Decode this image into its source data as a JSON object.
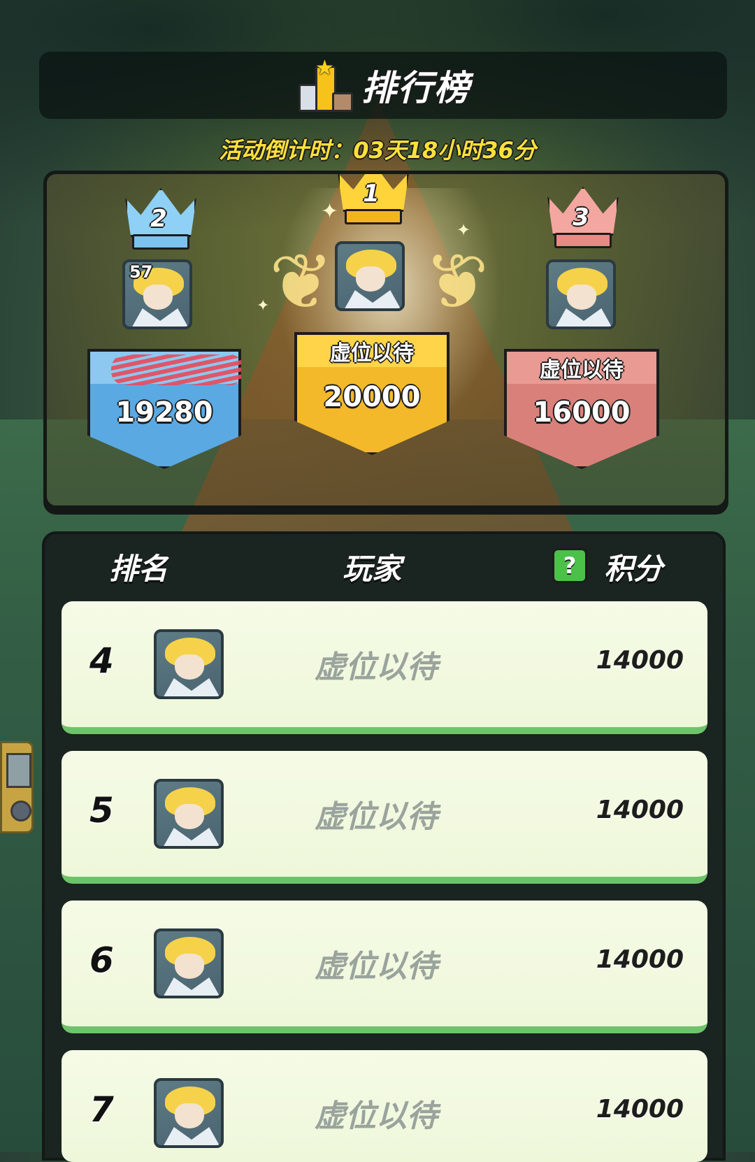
{
  "header": {
    "title": "排行榜",
    "trophy_icon": "podium-trophy-icon"
  },
  "countdown": "活动倒计时：03天18小时36分",
  "podium": {
    "first": {
      "rank": "1",
      "name": "虚位以待",
      "score": "20000",
      "color": "#f3b92a"
    },
    "second": {
      "rank": "2",
      "level": "57",
      "score": "19280",
      "color": "#5aa9e3"
    },
    "third": {
      "rank": "3",
      "name": "虚位以待",
      "score": "16000",
      "color": "#d9807b"
    }
  },
  "board": {
    "columns": {
      "rank": "排名",
      "player": "玩家",
      "score": "积分",
      "help": "?"
    },
    "rows": [
      {
        "rank": "4",
        "name": "虚位以待",
        "score": "14000"
      },
      {
        "rank": "5",
        "name": "虚位以待",
        "score": "14000"
      },
      {
        "rank": "6",
        "name": "虚位以待",
        "score": "14000"
      },
      {
        "rank": "7",
        "name": "虚位以待",
        "score": "14000"
      }
    ]
  },
  "colors": {
    "accent_green": "#4cc14a",
    "row_bg": "#f5fbe6",
    "gold": "#ffe13a"
  }
}
